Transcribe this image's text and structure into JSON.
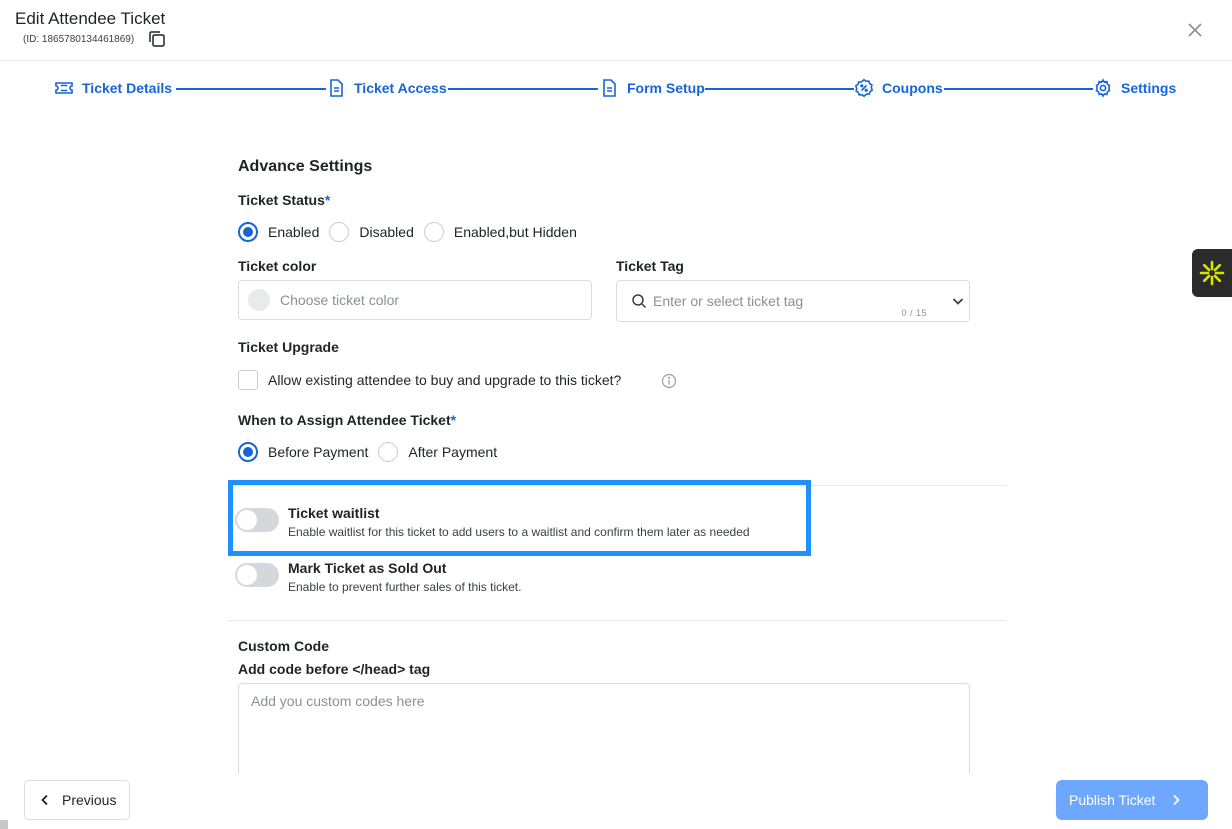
{
  "header": {
    "title": "Edit Attendee Ticket",
    "id_text": "(ID: 1865780134461869)"
  },
  "stepper": {
    "steps": [
      {
        "label": "Ticket Details",
        "icon": "ticket-icon"
      },
      {
        "label": "Ticket Access",
        "icon": "document-icon"
      },
      {
        "label": "Form Setup",
        "icon": "document-icon"
      },
      {
        "label": "Coupons",
        "icon": "coupon-icon"
      },
      {
        "label": "Settings",
        "icon": "gear-icon"
      }
    ]
  },
  "advance": {
    "title": "Advance Settings",
    "ticket_status": {
      "label": "Ticket Status",
      "required": "*",
      "options": [
        "Enabled",
        "Disabled",
        "Enabled,but Hidden"
      ],
      "selected": "Enabled"
    },
    "ticket_color": {
      "label": "Ticket color",
      "placeholder": "Choose ticket color"
    },
    "ticket_tag": {
      "label": "Ticket Tag",
      "placeholder": "Enter or select ticket tag",
      "counter": "0 / 15"
    },
    "ticket_upgrade": {
      "label": "Ticket Upgrade",
      "checkbox_label": "Allow existing attendee to buy and upgrade to this ticket?"
    },
    "assign": {
      "label": "When to Assign Attendee Ticket",
      "required": "*",
      "options": [
        "Before Payment",
        "After Payment"
      ],
      "selected": "Before Payment"
    },
    "waitlist": {
      "title": "Ticket waitlist",
      "description": "Enable waitlist for this ticket to add users to a waitlist and confirm them later as needed"
    },
    "sold_out": {
      "title": "Mark Ticket as Sold Out",
      "description": "Enable to prevent further sales of this ticket."
    }
  },
  "custom_code": {
    "title": "Custom Code",
    "head_label": "Add code before </head> tag",
    "placeholder": "Add you custom codes here"
  },
  "footer": {
    "previous": "Previous",
    "publish": "Publish Ticket"
  },
  "colors": {
    "accent": "#1565d8",
    "highlight": "#1e90ff",
    "publish_bg": "#6ea8fe"
  }
}
